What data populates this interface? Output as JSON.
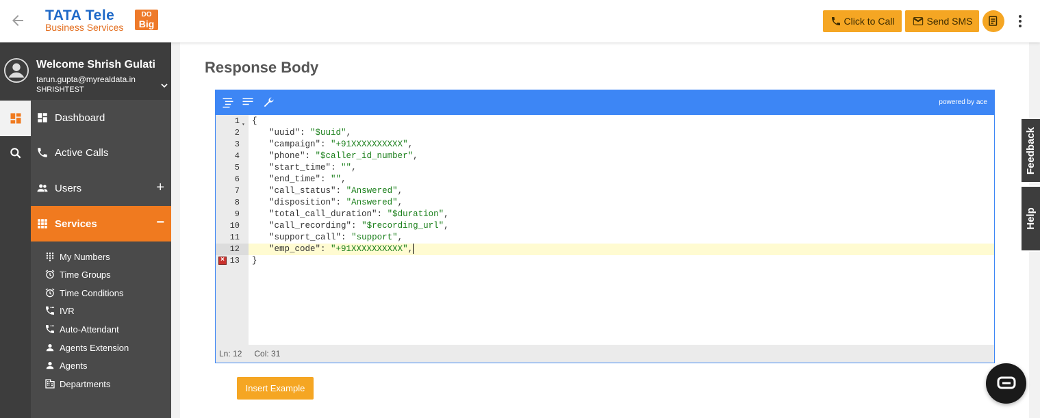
{
  "header": {
    "logo_line1": "TATA Tele",
    "logo_line2": "Business Services",
    "logo_badge_top": "DO",
    "logo_badge_bottom": "Big",
    "click_to_call": "Click to Call",
    "send_sms": "Send SMS"
  },
  "profile": {
    "welcome": "Welcome Shrish Gulati",
    "email": "tarun.gupta@myrealdata.in",
    "org": "SHRISHTEST"
  },
  "nav": {
    "dashboard": "Dashboard",
    "active_calls": "Active Calls",
    "users": "Users",
    "services": "Services",
    "users_toggle": "+",
    "services_toggle": "−"
  },
  "services_items": [
    {
      "label": "My Numbers",
      "icon": "dialpad-icon"
    },
    {
      "label": "Time Groups",
      "icon": "alarm-icon"
    },
    {
      "label": "Time Conditions",
      "icon": "alarm-icon"
    },
    {
      "label": "IVR",
      "icon": "phone-forward-icon"
    },
    {
      "label": "Auto-Attendant",
      "icon": "phone-forward-icon"
    },
    {
      "label": "Agents Extension",
      "icon": "person-icon"
    },
    {
      "label": "Agents",
      "icon": "person-icon"
    },
    {
      "label": "Departments",
      "icon": "building-icon"
    }
  ],
  "main": {
    "title": "Response Body",
    "powered_by": "powered by ace",
    "insert_example": "Insert Example"
  },
  "editor": {
    "lines": [
      {
        "n": "1",
        "code": "{"
      },
      {
        "n": "2",
        "key": "\"uuid\"",
        "val": "\"$uuid\""
      },
      {
        "n": "3",
        "key": "\"campaign\"",
        "val": "\"+91XXXXXXXXXX\""
      },
      {
        "n": "4",
        "key": "\"phone\"",
        "val": "\"$caller_id_number\""
      },
      {
        "n": "5",
        "key": "\"start_time\"",
        "val": "\"\""
      },
      {
        "n": "6",
        "key": "\"end_time\"",
        "val": "\"\""
      },
      {
        "n": "7",
        "key": "\"call_status\"",
        "val": "\"Answered\""
      },
      {
        "n": "8",
        "key": "\"disposition\"",
        "val": "\"Answered\""
      },
      {
        "n": "9",
        "key": "\"total_call_duration\"",
        "val": "\"$duration\""
      },
      {
        "n": "10",
        "key": "\"call_recording\"",
        "val": "\"$recording_url\""
      },
      {
        "n": "11",
        "key": "\"support_call\"",
        "val": "\"support\""
      },
      {
        "n": "12",
        "key": "\"emp_code\"",
        "val": "\"+91XXXXXXXXXX\""
      },
      {
        "n": "13",
        "code": "}"
      }
    ],
    "active_line": 12,
    "error_line": 13,
    "status_ln": "Ln: 12",
    "status_col": "Col: 31"
  },
  "side_tabs": {
    "feedback": "Feedback",
    "help": "Help"
  },
  "colors": {
    "accent_orange": "#f5a623",
    "nav_active": "#f07a1f",
    "editor_blue": "#3d86f5",
    "string_green": "#1a7f1a"
  }
}
